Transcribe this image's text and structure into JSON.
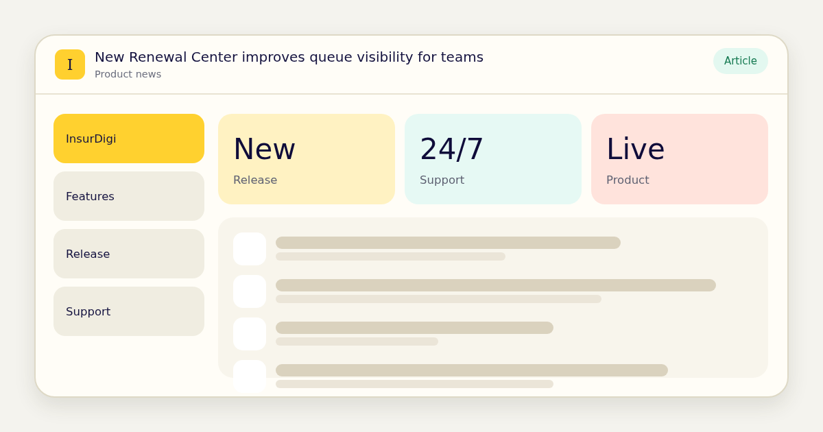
{
  "header": {
    "logo_letter": "I",
    "title": "New Renewal Center improves queue visibility for teams",
    "subtitle": "Product news",
    "badge": "Article"
  },
  "sidebar": {
    "items": [
      {
        "label": "InsurDigi",
        "selected": true
      },
      {
        "label": "Features",
        "selected": false
      },
      {
        "label": "Release",
        "selected": false
      },
      {
        "label": "Support",
        "selected": false
      }
    ]
  },
  "stats": [
    {
      "value": "New",
      "label": "Release",
      "color": "#fff2c2"
    },
    {
      "value": "24/7",
      "label": "Support",
      "color": "#e6f9f4"
    },
    {
      "value": "Live",
      "label": "Product",
      "color": "#ffe3dc"
    }
  ]
}
